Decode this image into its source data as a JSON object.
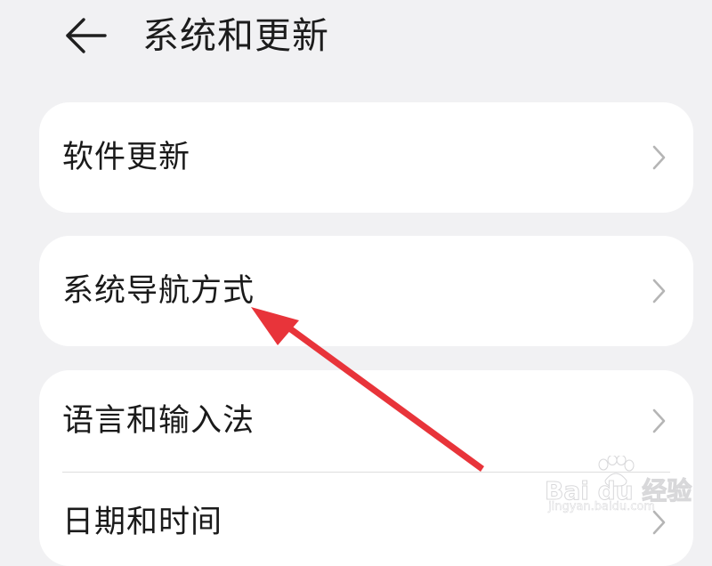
{
  "header": {
    "title": "系统和更新",
    "back_icon": "arrow-left-icon"
  },
  "settings": {
    "group1": [
      {
        "label": "软件更新"
      }
    ],
    "group2": [
      {
        "label": "系统导航方式"
      }
    ],
    "group3": [
      {
        "label": "语言和输入法"
      },
      {
        "label": "日期和时间"
      }
    ],
    "row_icon": "chevron-right-icon"
  },
  "annotation": {
    "arrow_color": "#e8343a",
    "target": "系统导航方式"
  },
  "watermark": {
    "brand": "Bai du 经验",
    "url": "jingyan.baidu.com"
  },
  "colors": {
    "background": "#f1f1f3",
    "card": "#ffffff",
    "chevron": "#b5b5b5"
  }
}
